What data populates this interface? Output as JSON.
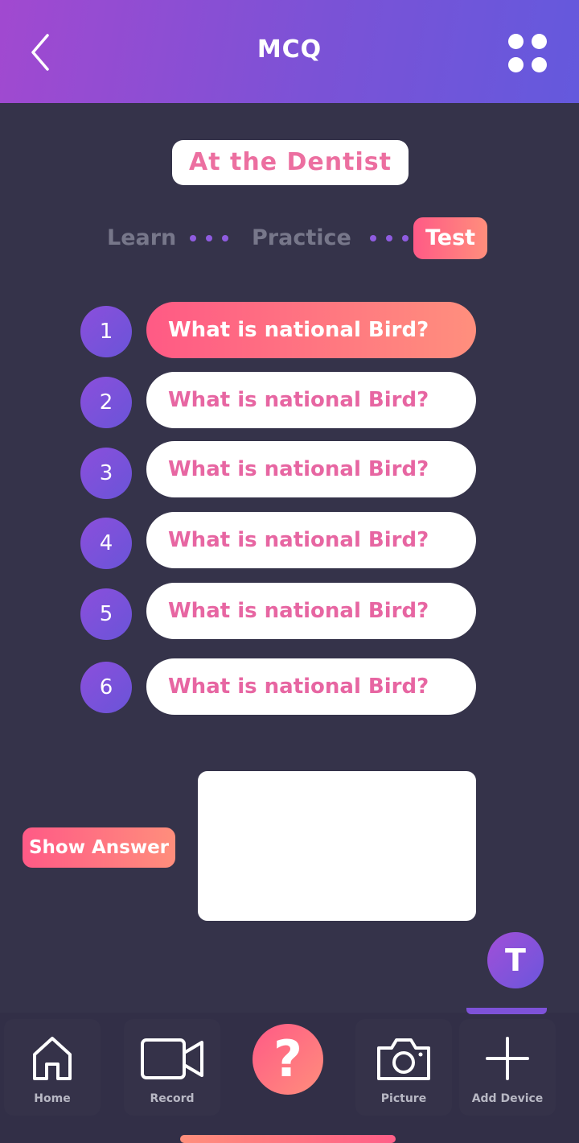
{
  "header": {
    "title": "MCQ",
    "back_icon": "chevron-left-icon",
    "menu_icon": "grid-dots-icon"
  },
  "topic": "At the Dentist",
  "steps": [
    {
      "label": "Learn",
      "active": false
    },
    {
      "label": "Practice",
      "active": false
    },
    {
      "label": "Test",
      "active": true
    }
  ],
  "questions": [
    {
      "number": "1",
      "text": "What is national Bird?",
      "selected": true
    },
    {
      "number": "2",
      "text": "What is national Bird?",
      "selected": false
    },
    {
      "number": "3",
      "text": "What is national Bird?",
      "selected": false
    },
    {
      "number": "4",
      "text": "What is national Bird?",
      "selected": false
    },
    {
      "number": "5",
      "text": "What is national Bird?",
      "selected": false
    },
    {
      "number": "6",
      "text": "What is national Bird?",
      "selected": false
    }
  ],
  "show_answer_label": "Show Answer",
  "answer_text": "",
  "avatar_initial": "T",
  "bottom_nav": {
    "items": [
      {
        "label": "Home",
        "icon": "home-icon"
      },
      {
        "label": "Record",
        "icon": "video-camera-icon"
      },
      {
        "label": "",
        "icon": "help-icon",
        "glyph": "?"
      },
      {
        "label": "Picture",
        "icon": "camera-icon"
      },
      {
        "label": "Add Device",
        "icon": "plus-icon"
      }
    ]
  },
  "colors": {
    "background": "#35334a",
    "header_gradient": [
      "#a149d0",
      "#6459dd"
    ],
    "accent_gradient": [
      "#ff5a86",
      "#ff8e7c"
    ],
    "question_text": "#e766a2",
    "number_circle": "#7b52d9"
  }
}
